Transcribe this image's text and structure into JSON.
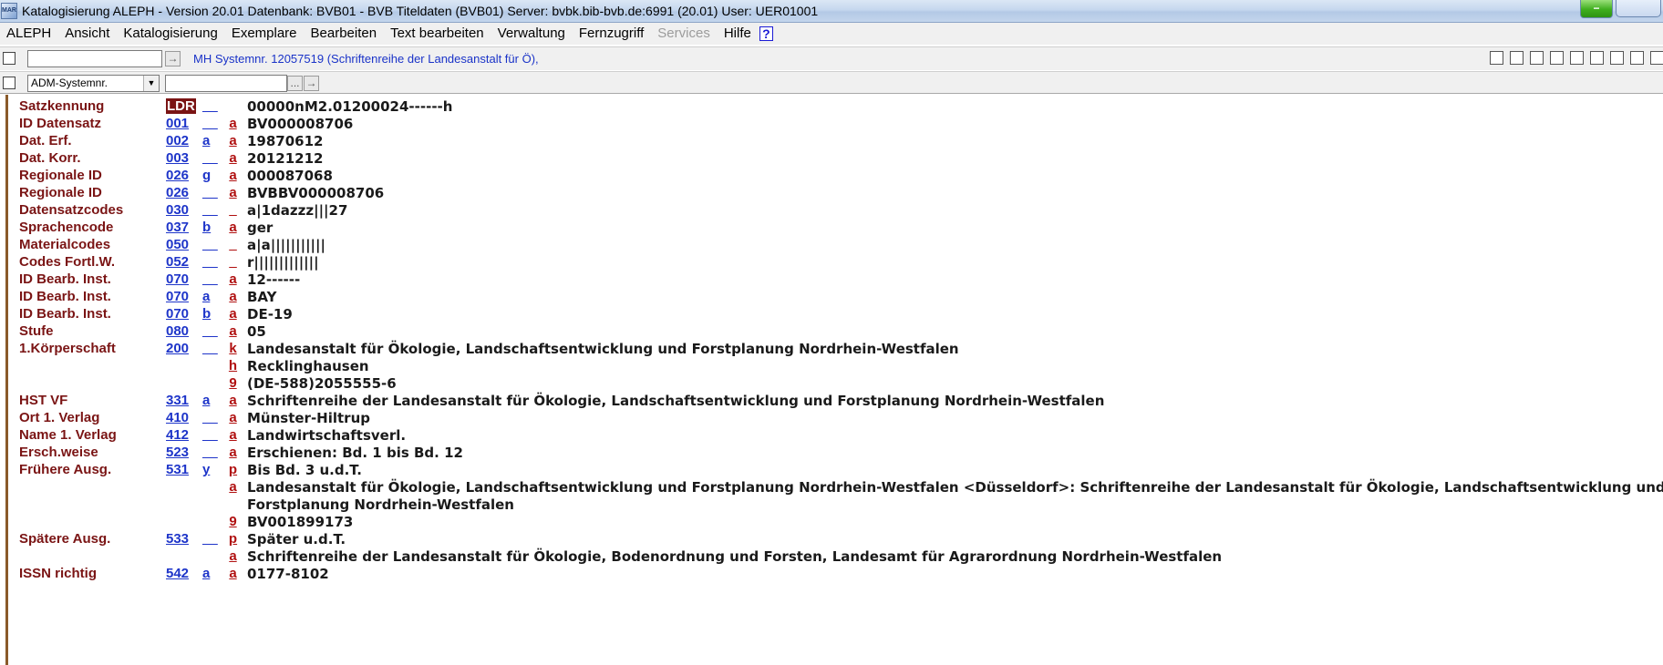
{
  "window": {
    "title": "Katalogisierung ALEPH - Version 20.01  Datenbank:  BVB01 - BVB Titeldaten (BVB01)  Server: bvbk.bib-bvb.de:6991 (20.01)  User:  UER01001",
    "app_icon_text": "MARC",
    "minimize_glyph": "−"
  },
  "menu": {
    "items": [
      "ALEPH",
      "Ansicht",
      "Katalogisierung",
      "Exemplare",
      "Bearbeiten",
      "Text bearbeiten",
      "Verwaltung",
      "Fernzugriff",
      "Services",
      "Hilfe"
    ],
    "disabled": "Services",
    "help_glyph": "?"
  },
  "toolbar": {
    "input1_value": "",
    "mh_text": "MH Systemnr. 12057519 (Schriftenreihe der Landesanstalt für Ö),",
    "select_value": "ADM-Systemnr.",
    "input2_value": "",
    "ellipsis": "...",
    "arrow": "→"
  },
  "record": [
    {
      "label": "Satzkennung",
      "tag": "LDR",
      "ind1": "__",
      "ind2": "_",
      "code": "",
      "value": "00000nM2.01200024------h"
    },
    {
      "label": "ID Datensatz",
      "tag": "001",
      "ind1": "__",
      "ind2": "",
      "code": "a",
      "value": "BV000008706"
    },
    {
      "label": "Dat. Erf.",
      "tag": "002",
      "ind1": "a",
      "ind2": "",
      "code": "a",
      "value": "19870612"
    },
    {
      "label": "Dat. Korr.",
      "tag": "003",
      "ind1": "__",
      "ind2": "",
      "code": "a",
      "value": "20121212"
    },
    {
      "label": "Regionale ID",
      "tag": "026",
      "ind1": "g",
      "ind2": "",
      "code": "a",
      "value": "000087068"
    },
    {
      "label": "Regionale ID",
      "tag": "026",
      "ind1": "__",
      "ind2": "",
      "code": "a",
      "value": "BVBBV000008706"
    },
    {
      "label": "Datensatzcodes",
      "tag": "030",
      "ind1": "__",
      "ind2": "",
      "code": "_",
      "value": "a|1dazzz|||27"
    },
    {
      "label": "Sprachencode",
      "tag": "037",
      "ind1": "b",
      "ind2": "",
      "code": "a",
      "value": "ger"
    },
    {
      "label": "Materialcodes",
      "tag": "050",
      "ind1": "__",
      "ind2": "",
      "code": "_",
      "value": "a|a|||||||||||"
    },
    {
      "label": "Codes Fortl.W.",
      "tag": "052",
      "ind1": "__",
      "ind2": "",
      "code": "_",
      "value": "r|||||||||||||"
    },
    {
      "label": "ID Bearb. Inst.",
      "tag": "070",
      "ind1": "__",
      "ind2": "",
      "code": "a",
      "value": "12------"
    },
    {
      "label": "ID Bearb. Inst.",
      "tag": "070",
      "ind1": "a",
      "ind2": "",
      "code": "a",
      "value": "BAY"
    },
    {
      "label": "ID Bearb. Inst.",
      "tag": "070",
      "ind1": "b",
      "ind2": "",
      "code": "a",
      "value": "DE-19"
    },
    {
      "label": "Stufe",
      "tag": "080",
      "ind1": "__",
      "ind2": "",
      "code": "a",
      "value": "05"
    },
    {
      "label": "1.Körperschaft",
      "tag": "200",
      "ind1": "__",
      "ind2": "",
      "code": "k",
      "value": "Landesanstalt für Ökologie, Landschaftsentwicklung und Forstplanung Nordrhein-Westfalen"
    },
    {
      "label": "",
      "tag": "",
      "ind1": "",
      "ind2": "",
      "code": "h",
      "value": "Recklinghausen"
    },
    {
      "label": "",
      "tag": "",
      "ind1": "",
      "ind2": "",
      "code": "9",
      "value": "(DE-588)2055555-6"
    },
    {
      "label": "HST VF",
      "tag": "331",
      "ind1": "a",
      "ind2": "",
      "code": "a",
      "value": "Schriftenreihe der Landesanstalt für Ökologie, Landschaftsentwicklung und Forstplanung Nordrhein-Westfalen"
    },
    {
      "label": "Ort 1. Verlag",
      "tag": "410",
      "ind1": "__",
      "ind2": "",
      "code": "a",
      "value": "Münster-Hiltrup"
    },
    {
      "label": "Name 1. Verlag",
      "tag": "412",
      "ind1": "__",
      "ind2": "",
      "code": "a",
      "value": "Landwirtschaftsverl."
    },
    {
      "label": "Ersch.weise",
      "tag": "523",
      "ind1": "__",
      "ind2": "",
      "code": "a",
      "value": "Erschienen: Bd. 1 bis Bd. 12"
    },
    {
      "label": "Frühere Ausg.",
      "tag": "531",
      "ind1": "y",
      "ind2": "",
      "code": "p",
      "value": "Bis Bd. 3 u.d.T."
    },
    {
      "label": "",
      "tag": "",
      "ind1": "",
      "ind2": "",
      "code": "a",
      "value": "Landesanstalt für Ökologie, Landschaftsentwicklung und Forstplanung Nordrhein-Westfalen <Düsseldorf>: Schriftenreihe der Landesanstalt für Ökologie, Landschaftsentwicklung und"
    },
    {
      "label": "",
      "tag": "",
      "ind1": "",
      "ind2": "",
      "code": "",
      "value": "Forstplanung Nordrhein-Westfalen"
    },
    {
      "label": "",
      "tag": "",
      "ind1": "",
      "ind2": "",
      "code": "9",
      "value": "BV001899173"
    },
    {
      "label": "Spätere Ausg.",
      "tag": "533",
      "ind1": "__",
      "ind2": "",
      "code": "p",
      "value": "Später u.d.T."
    },
    {
      "label": "",
      "tag": "",
      "ind1": "",
      "ind2": "",
      "code": "a",
      "value": "Schriftenreihe der Landesanstalt für Ökologie, Bodenordnung und Forsten, Landesamt für Agrarordnung Nordrhein-Westfalen"
    },
    {
      "label": "ISSN richtig",
      "tag": "542",
      "ind1": "a",
      "ind2": "",
      "code": "a",
      "value": "0177-8102"
    }
  ]
}
